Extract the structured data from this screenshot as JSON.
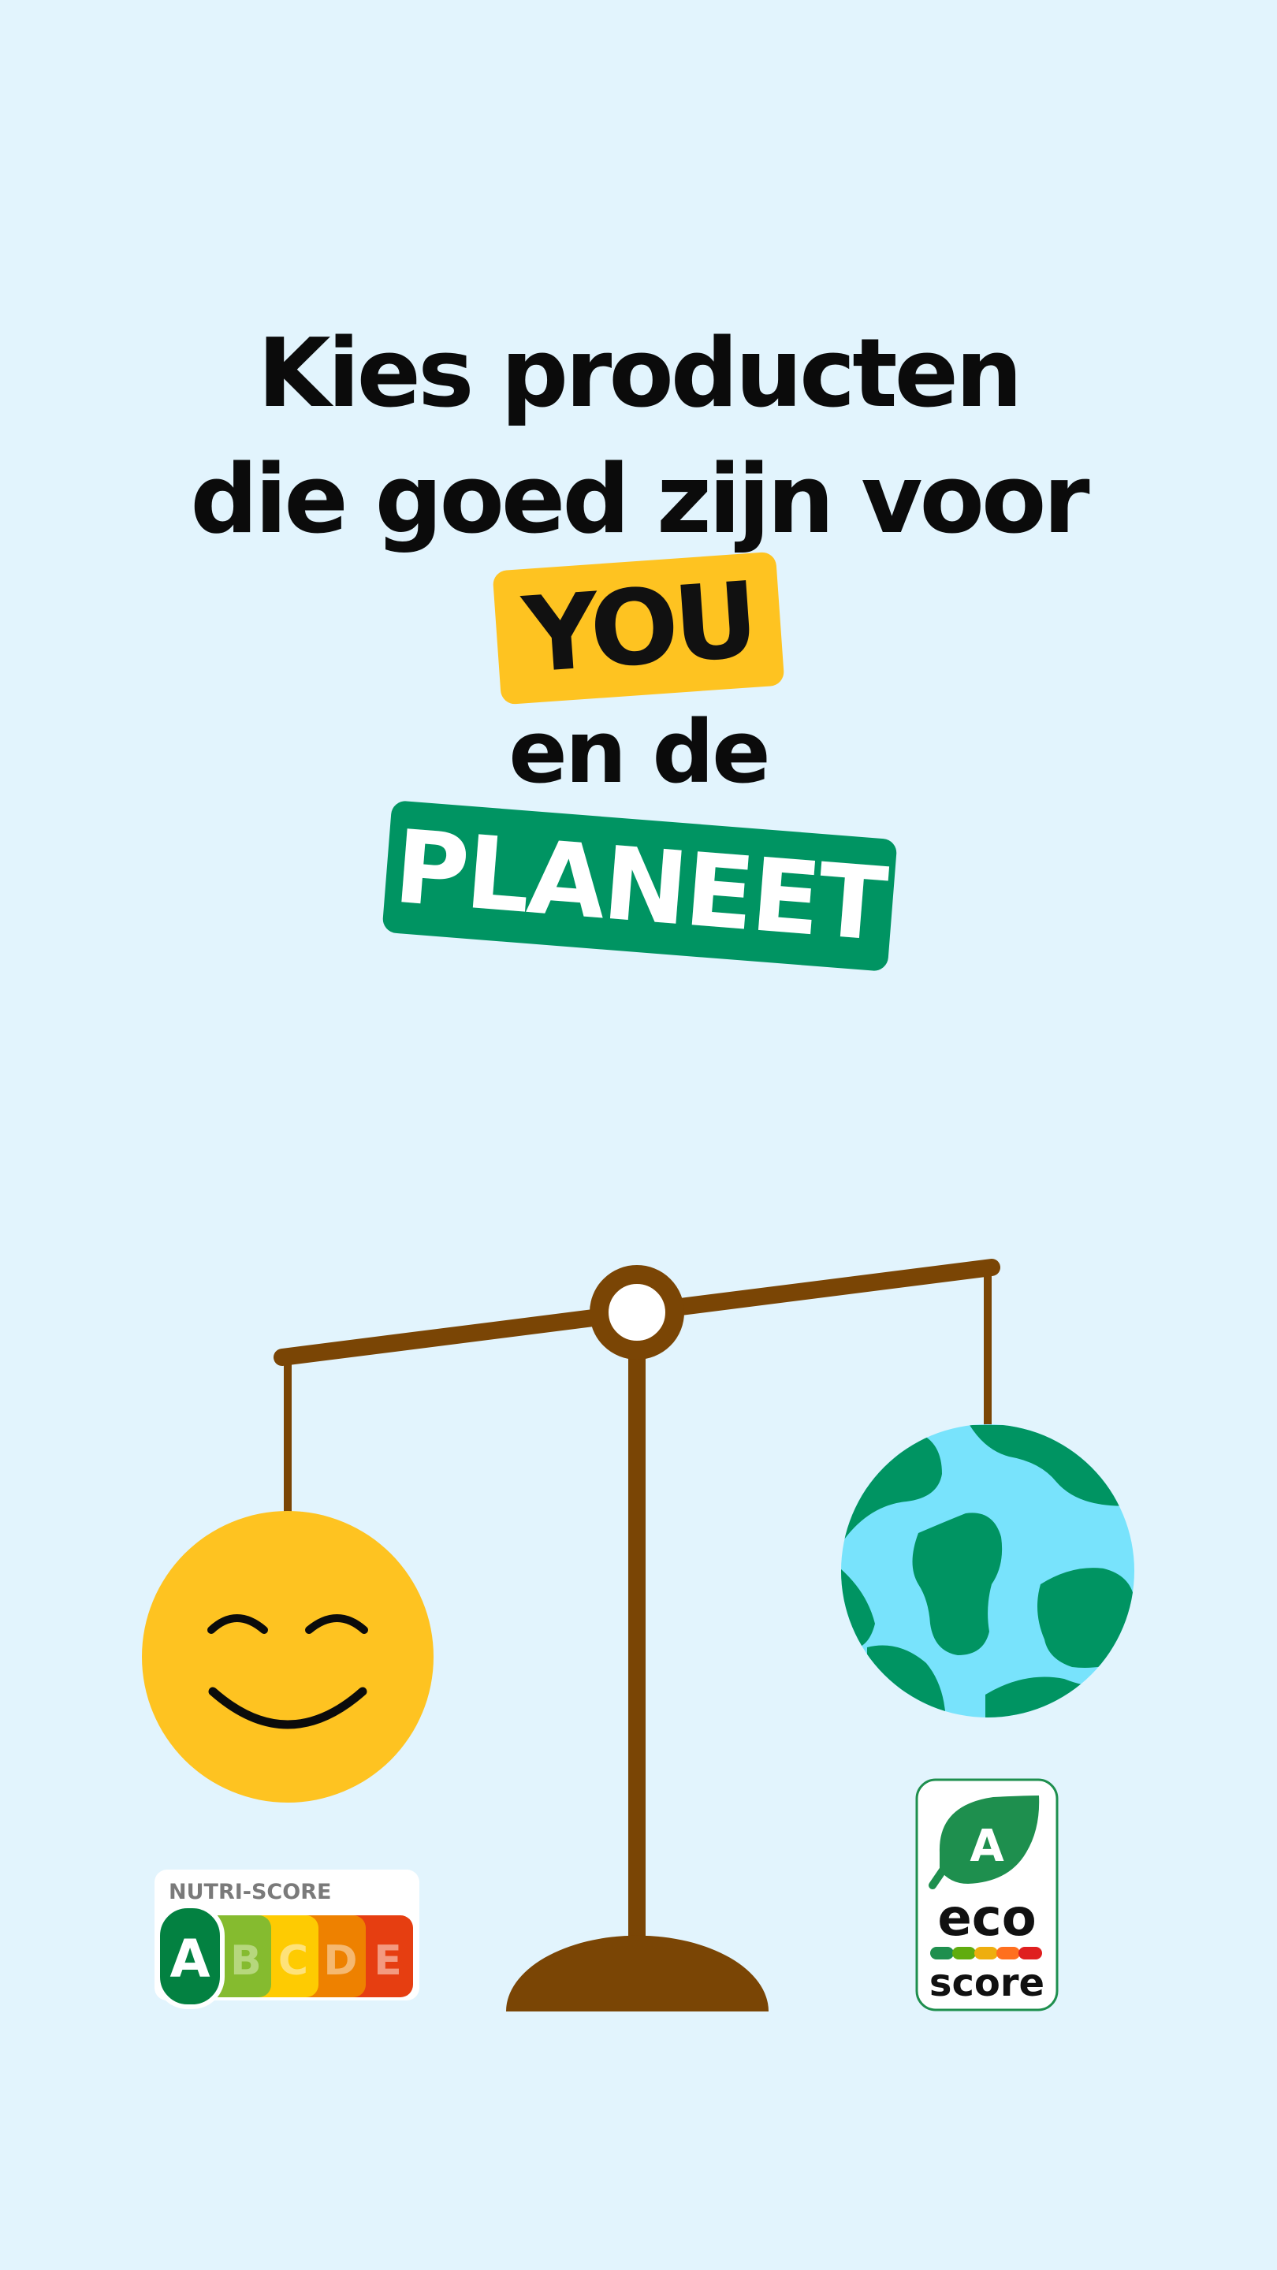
{
  "headline": {
    "line1": "Kies producten",
    "line2": "die goed zijn voor"
  },
  "tag_you": "YOU",
  "mid_text": "en de",
  "tag_planeet": "PLANEET",
  "nutri_score": {
    "title": "NUTRI-SCORE",
    "grades": [
      "A",
      "B",
      "C",
      "D",
      "E"
    ],
    "selected": "A",
    "colors": [
      "#038141",
      "#85bb2f",
      "#fecb02",
      "#ee8100",
      "#e63e11"
    ]
  },
  "eco_score": {
    "grade": "A",
    "word1": "eco",
    "word2": "score",
    "colors": [
      "#1e8f4e",
      "#60ac0e",
      "#eeae0e",
      "#ff6f1e",
      "#df1f1f"
    ]
  },
  "colors": {
    "background": "#e2f4fd",
    "yellow": "#fec321",
    "green": "#009462",
    "scale_brown": "#7a4505",
    "ocean": "#78e3fc"
  },
  "icons": [
    "smiley-face-icon",
    "earth-globe-icon",
    "balance-scale-icon"
  ]
}
